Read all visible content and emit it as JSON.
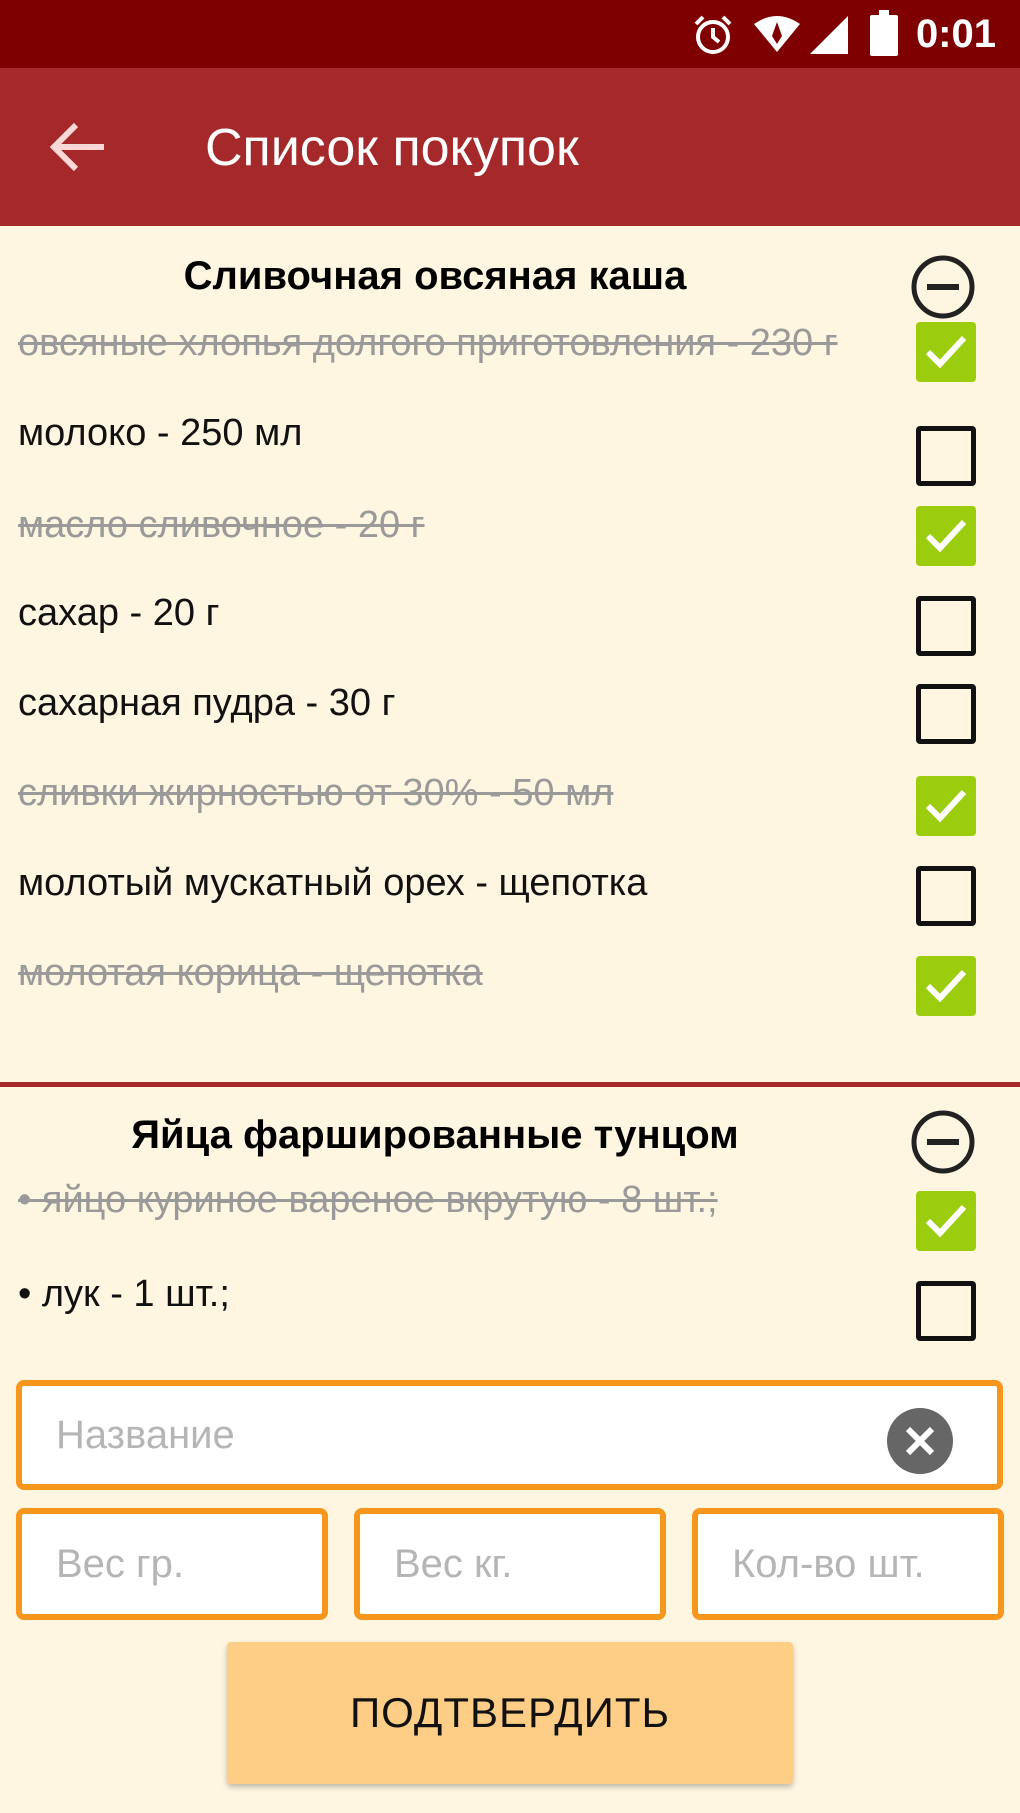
{
  "status_bar": {
    "time": "0:01",
    "icons": [
      "alarm-icon",
      "wifi-icon",
      "signal-icon",
      "battery-icon"
    ]
  },
  "app_bar": {
    "title": "Список покупок",
    "back_icon": "arrow-left-icon"
  },
  "recipes": [
    {
      "title": "Сливочная овсяная каша",
      "items": [
        {
          "text": "овсяные хлопья долгого приготовления - 230 г",
          "checked": true
        },
        {
          "text": "молоко - 250 мл",
          "checked": false
        },
        {
          "text": "масло сливочное - 20 г",
          "checked": true
        },
        {
          "text": "сахар - 20 г",
          "checked": false
        },
        {
          "text": "сахарная пудра - 30 г",
          "checked": false
        },
        {
          "text": "сливки жирностью от 30% - 50 мл",
          "checked": true
        },
        {
          "text": "молотый мускатный орех - щепотка",
          "checked": false
        },
        {
          "text": "молотая корица - щепотка",
          "checked": true
        }
      ]
    },
    {
      "title": "Яйца фаршированные тунцом",
      "items": [
        {
          "text": "• яйцо куриное вареное вкрутую - 8 шт.;",
          "checked": true
        },
        {
          "text": "• лук - 1 шт.;",
          "checked": false
        }
      ]
    }
  ],
  "form": {
    "name_placeholder": "Название",
    "name_value": "",
    "weight_g_placeholder": "Вес гр.",
    "weight_kg_placeholder": "Вес кг.",
    "count_placeholder": "Кол-во шт.",
    "confirm_label": "ПОДТВЕРДИТЬ"
  },
  "colors": {
    "status_bar": "#7E0000",
    "app_bar": "#A5292A",
    "background": "#FEF6E0",
    "check_green": "#9CCC0E",
    "input_border": "#F7961D",
    "confirm_button": "#FFCE86"
  }
}
